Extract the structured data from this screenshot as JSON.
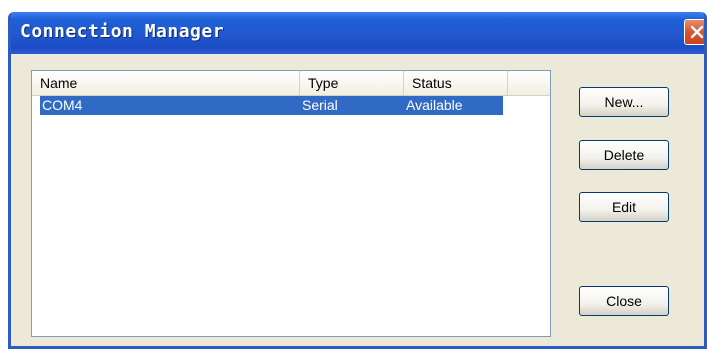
{
  "window": {
    "title": "Connection Manager"
  },
  "list": {
    "columns": [
      "Name",
      "Type",
      "Status"
    ],
    "rows": [
      {
        "name": "COM4",
        "type": "Serial",
        "status": "Available",
        "selected": true
      }
    ]
  },
  "buttons": {
    "new_label": "New...",
    "delete_label": "Delete",
    "edit_label": "Edit",
    "close_label": "Close"
  },
  "colors": {
    "titlebar": "#2257cf",
    "selection": "#316ac5",
    "close_button": "#d8562f"
  },
  "icons": {
    "close": "close-x-icon"
  }
}
